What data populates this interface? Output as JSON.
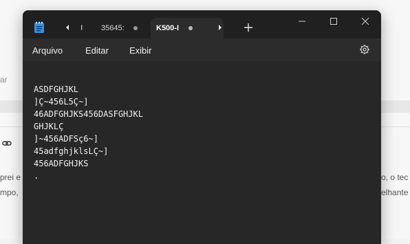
{
  "background_page": {
    "left_snippet": "ar",
    "text_line_1_left": "prei e",
    "text_line_2_left": "mpo,",
    "text_line_1_right": "o, o tec",
    "text_line_2_right": "elhante"
  },
  "window": {
    "tabs": [
      {
        "title": "35645:"
      },
      {
        "title": "K500-I"
      }
    ]
  },
  "menu": {
    "items": [
      "Arquivo",
      "Editar",
      "Exibir"
    ]
  },
  "editor": {
    "lines": [
      "ASDFGHJKL",
      "]Ç~456L5Ç~]",
      "46ADFGHJKS456DASFGHJKL",
      "GHJKLÇ",
      "]~456ADFSç6~]",
      "45adfghjklsLÇ~]",
      "456ADFGHJKS",
      "."
    ]
  },
  "colors": {
    "window_bg": "#202020",
    "menubar_bg": "#2c2c2c",
    "editor_bg": "#272727",
    "text": "#f2f2f2"
  },
  "icons": {
    "app": "notepad-icon",
    "settings": "gear-icon",
    "new_tab": "plus-icon",
    "back": "chevron-left-icon",
    "forward": "chevron-right-icon",
    "link": "link-icon"
  }
}
